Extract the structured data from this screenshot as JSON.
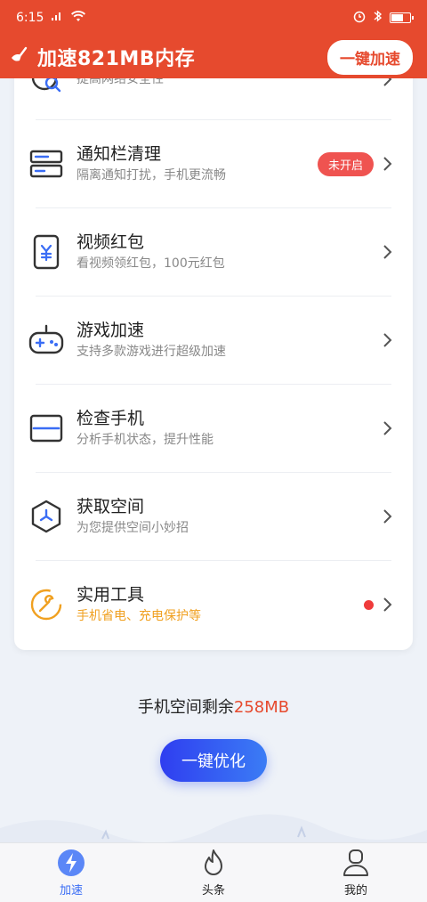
{
  "status": {
    "time": "6:15"
  },
  "header": {
    "title": "加速821MB内存",
    "boost_label": "一键加速"
  },
  "items": [
    {
      "title": "",
      "subtitle": "提高网络安全性",
      "icon": "network-security-icon"
    },
    {
      "title": "通知栏清理",
      "subtitle": "隔离通知打扰，手机更流畅",
      "badge": "未开启",
      "icon": "notification-clean-icon"
    },
    {
      "title": "视频红包",
      "subtitle": "看视频领红包，100元红包",
      "icon": "video-redpacket-icon"
    },
    {
      "title": "游戏加速",
      "subtitle": "支持多款游戏进行超级加速",
      "icon": "gamepad-icon"
    },
    {
      "title": "检查手机",
      "subtitle": "分析手机状态，提升性能",
      "icon": "scan-phone-icon"
    },
    {
      "title": "获取空间",
      "subtitle": "为您提供空间小妙招",
      "icon": "space-cube-icon"
    },
    {
      "title": "实用工具",
      "subtitle": "手机省电、充电保护等",
      "icon": "tools-icon",
      "dot": true
    }
  ],
  "storage": {
    "prefix": "手机空间剩余",
    "value": "258MB"
  },
  "optimize_label": "一键优化",
  "tabs": [
    {
      "label": "加速",
      "icon": "lightning-icon",
      "active": true
    },
    {
      "label": "头条",
      "icon": "flame-icon",
      "active": false
    },
    {
      "label": "我的",
      "icon": "user-icon",
      "active": false
    }
  ],
  "colors": {
    "accent": "#e64a2e",
    "blue": "#3a6df5",
    "badge": "#ef5350",
    "tool_orange": "#f0a020"
  }
}
